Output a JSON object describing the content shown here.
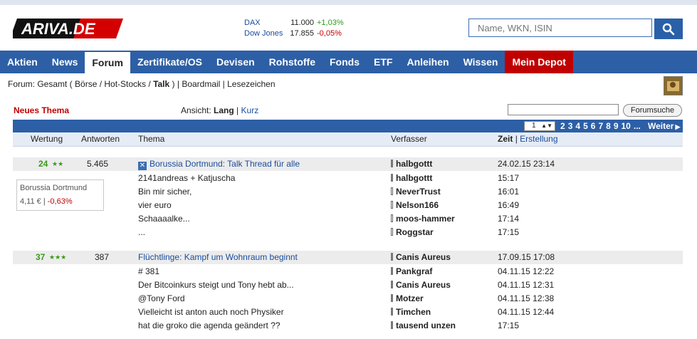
{
  "logo": {
    "text": "ARIVA.DE"
  },
  "ticker": [
    {
      "name": "DAX",
      "value": "11.000",
      "change": "+1,03%",
      "color": "#2e9a1a"
    },
    {
      "name": "Dow Jones",
      "value": "17.855",
      "change": "-0,05%",
      "color": "#c00000"
    }
  ],
  "search": {
    "placeholder": "Name, WKN, ISIN",
    "button_icon": "search-icon"
  },
  "nav": [
    "Aktien",
    "News",
    "Forum",
    "Zertifikate/OS",
    "Devisen",
    "Rohstoffe",
    "Fonds",
    "ETF",
    "Anleihen",
    "Wissen",
    "Mein Depot"
  ],
  "breadcrumb": {
    "prefix": "Forum: Gesamt ( Börse / Hot-Stocks /",
    "current": "Talk",
    "suffix": ") | Boardmail | Lesezeichen"
  },
  "toolbar": {
    "new_thread": "Neues Thema",
    "view_label": "Ansicht:",
    "view_long": "Lang",
    "view_sep": "|",
    "view_short": "Kurz",
    "forum_search_button": "Forumsuche",
    "page_select": "1",
    "pages": [
      "2",
      "3",
      "4",
      "5",
      "6",
      "7",
      "8",
      "9",
      "10",
      "..."
    ],
    "next": "Weiter"
  },
  "columns": {
    "rating": "Wertung",
    "replies": "Antworten",
    "topic": "Thema",
    "author": "Verfasser",
    "time": "Zeit",
    "time_sep": "|",
    "created": "Erstellung"
  },
  "threads": [
    {
      "rating": "24",
      "replies": "5.465",
      "title": "Borussia Dortmund: Talk Thread für alle",
      "author": "halbgottt",
      "time": "24.02.15 23:14",
      "quote": {
        "name": "Borussia Dortmund",
        "price": "4,11 € |",
        "change": "-0,63%"
      },
      "posts": [
        {
          "text": "2141andreas + Katjuscha",
          "author": "halbgottt",
          "time": "15:17"
        },
        {
          "text": "Bin mir sicher,",
          "author": "NeverTrust",
          "time": "16:01"
        },
        {
          "text": "vier euro",
          "author": "Nelson166",
          "time": "16:49"
        },
        {
          "text": "Schaaaalke...",
          "author": "moos-hammer",
          "time": "17:14"
        },
        {
          "text": "...",
          "author": "Roggstar",
          "time": "17:15"
        }
      ]
    },
    {
      "rating": "37",
      "replies": "387",
      "title": "Flüchtlinge: Kampf um Wohnraum beginnt",
      "author": "Canis Aureus",
      "time": "17.09.15 17:08",
      "posts": [
        {
          "text": "# 381",
          "author": "Pankgraf",
          "time": "04.11.15 12:22"
        },
        {
          "text": "Der Bitcoinkurs steigt und Tony hebt ab...",
          "author": "Canis Aureus",
          "time": "04.11.15 12:31"
        },
        {
          "text": "@Tony Ford",
          "author": "Motzer",
          "time": "04.11.15 12:38"
        },
        {
          "text": "Vielleicht ist anton auch noch Physiker",
          "author": "Timchen",
          "time": "04.11.15 12:44"
        },
        {
          "text": "hat die groko die agenda geändert ??",
          "author": "tausend unzen",
          "time": "17:15"
        }
      ]
    }
  ]
}
